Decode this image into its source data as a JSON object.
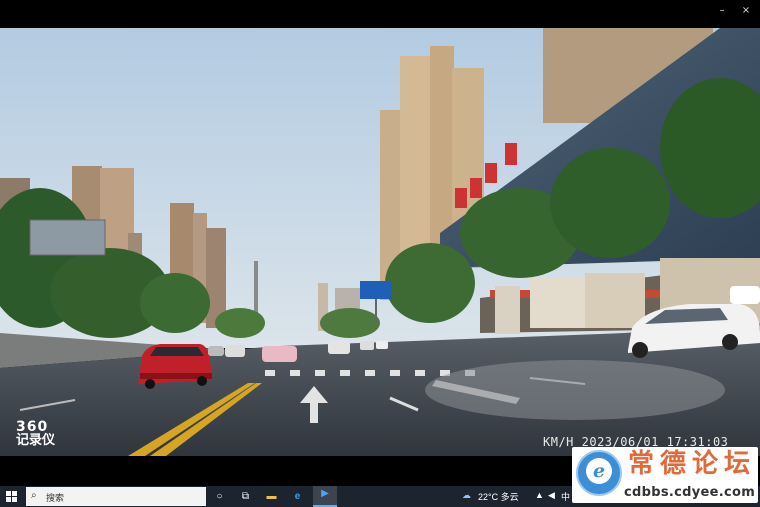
{
  "window": {
    "minimize_glyph": "–",
    "close_glyph": "×",
    "minimize_icon": "minimize-icon",
    "close_icon": "close-icon"
  },
  "video": {
    "sign_text": "",
    "overlay_logo_top": "360",
    "overlay_logo_bottom": "记录仪",
    "timestamp": "KM/H 2023/06/01 17:31:03"
  },
  "taskbar": {
    "search_placeholder": "搜索",
    "search_icon": "search-icon",
    "task_view_icon": "task-view-icon",
    "apps": [
      "file-explorer-icon",
      "edge-icon",
      "media-player-icon"
    ],
    "weather": "22°C 多云",
    "tray_icons": [
      "network-icon",
      "volume-icon",
      "language-icon"
    ]
  },
  "watermark": {
    "title": "常德论坛",
    "url": "cdbbs.cdyee.com",
    "badge_letter": "e"
  },
  "colors": {
    "sky_top": "#b9d0e6",
    "sky_bottom": "#d7e2ea",
    "road": "#3d444c",
    "lane_yellow": "#d6a524",
    "car_red": "#c0202a",
    "car_white": "#f2f2f2",
    "sign_blue": "#1f5fb8",
    "watermark_orange": "#e06a3a"
  }
}
